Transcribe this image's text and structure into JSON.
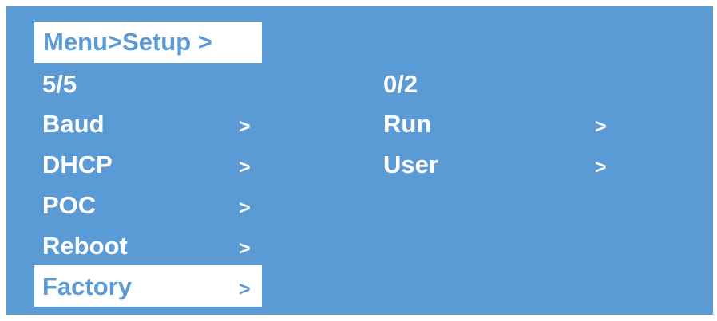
{
  "colors": {
    "background": "#5b9bd5",
    "text": "#ffffff",
    "highlight": "#ffffff"
  },
  "breadcrumb": "Menu>Setup >",
  "left_column": {
    "page_indicator": "5/5",
    "items": [
      {
        "label": "Baud",
        "arrow": ">"
      },
      {
        "label": "DHCP",
        "arrow": ">"
      },
      {
        "label": "POC",
        "arrow": ">"
      },
      {
        "label": "Reboot",
        "arrow": ">"
      },
      {
        "label": "Factory",
        "arrow": ">",
        "selected": true
      }
    ]
  },
  "right_column": {
    "page_indicator": "0/2",
    "items": [
      {
        "label": "Run",
        "arrow": ">"
      },
      {
        "label": "User",
        "arrow": ">"
      }
    ]
  }
}
